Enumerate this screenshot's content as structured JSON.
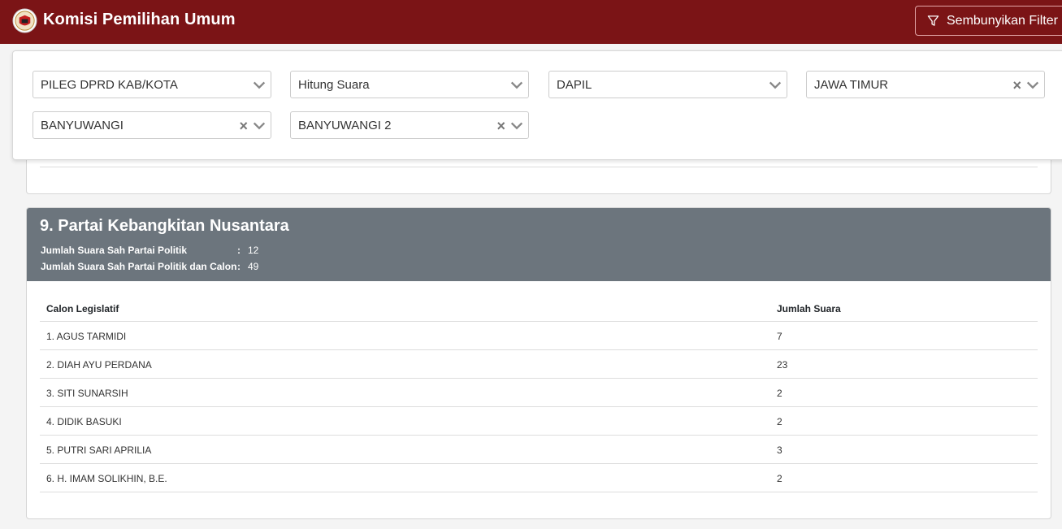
{
  "app": {
    "title": "Komisi Pemilihan Umum"
  },
  "header": {
    "filter_button_label": "Sembunyikan Filter"
  },
  "filters": [
    {
      "value": "PILEG DPRD KAB/KOTA",
      "clearable": false
    },
    {
      "value": "Hitung Suara",
      "clearable": false
    },
    {
      "value": "DAPIL",
      "clearable": false
    },
    {
      "value": "JAWA TIMUR",
      "clearable": true
    },
    {
      "value": "BANYUWANGI",
      "clearable": true
    },
    {
      "value": "BANYUWANGI 2",
      "clearable": true
    }
  ],
  "icons": {
    "logo": "kpu-logo-icon",
    "filter": "filter-icon",
    "clear": "clear-x-icon",
    "chevron": "chevron-down-icon"
  },
  "colors": {
    "topbar": "#7b1416",
    "card_header": "#6c757d"
  },
  "party": {
    "name": "9. Partai Kebangkitan Nusantara",
    "stats": [
      {
        "label": "Jumlah Suara Sah Partai Politik",
        "sep": ":",
        "value": "12"
      },
      {
        "label": "Jumlah Suara Sah Partai Politik dan Calon",
        "sep": ":",
        "value": "49"
      }
    ],
    "columns": [
      "Calon Legislatif",
      "Jumlah Suara"
    ],
    "candidates": [
      {
        "name": "1. AGUS TARMIDI",
        "votes": "7"
      },
      {
        "name": "2. DIAH AYU PERDANA",
        "votes": "23"
      },
      {
        "name": "3. SITI SUNARSIH",
        "votes": "2"
      },
      {
        "name": "4. DIDIK BASUKI",
        "votes": "2"
      },
      {
        "name": "5. PUTRI SARI APRILIA",
        "votes": "3"
      },
      {
        "name": "6. H. IMAM SOLIKHIN, B.E.",
        "votes": "2"
      }
    ]
  }
}
